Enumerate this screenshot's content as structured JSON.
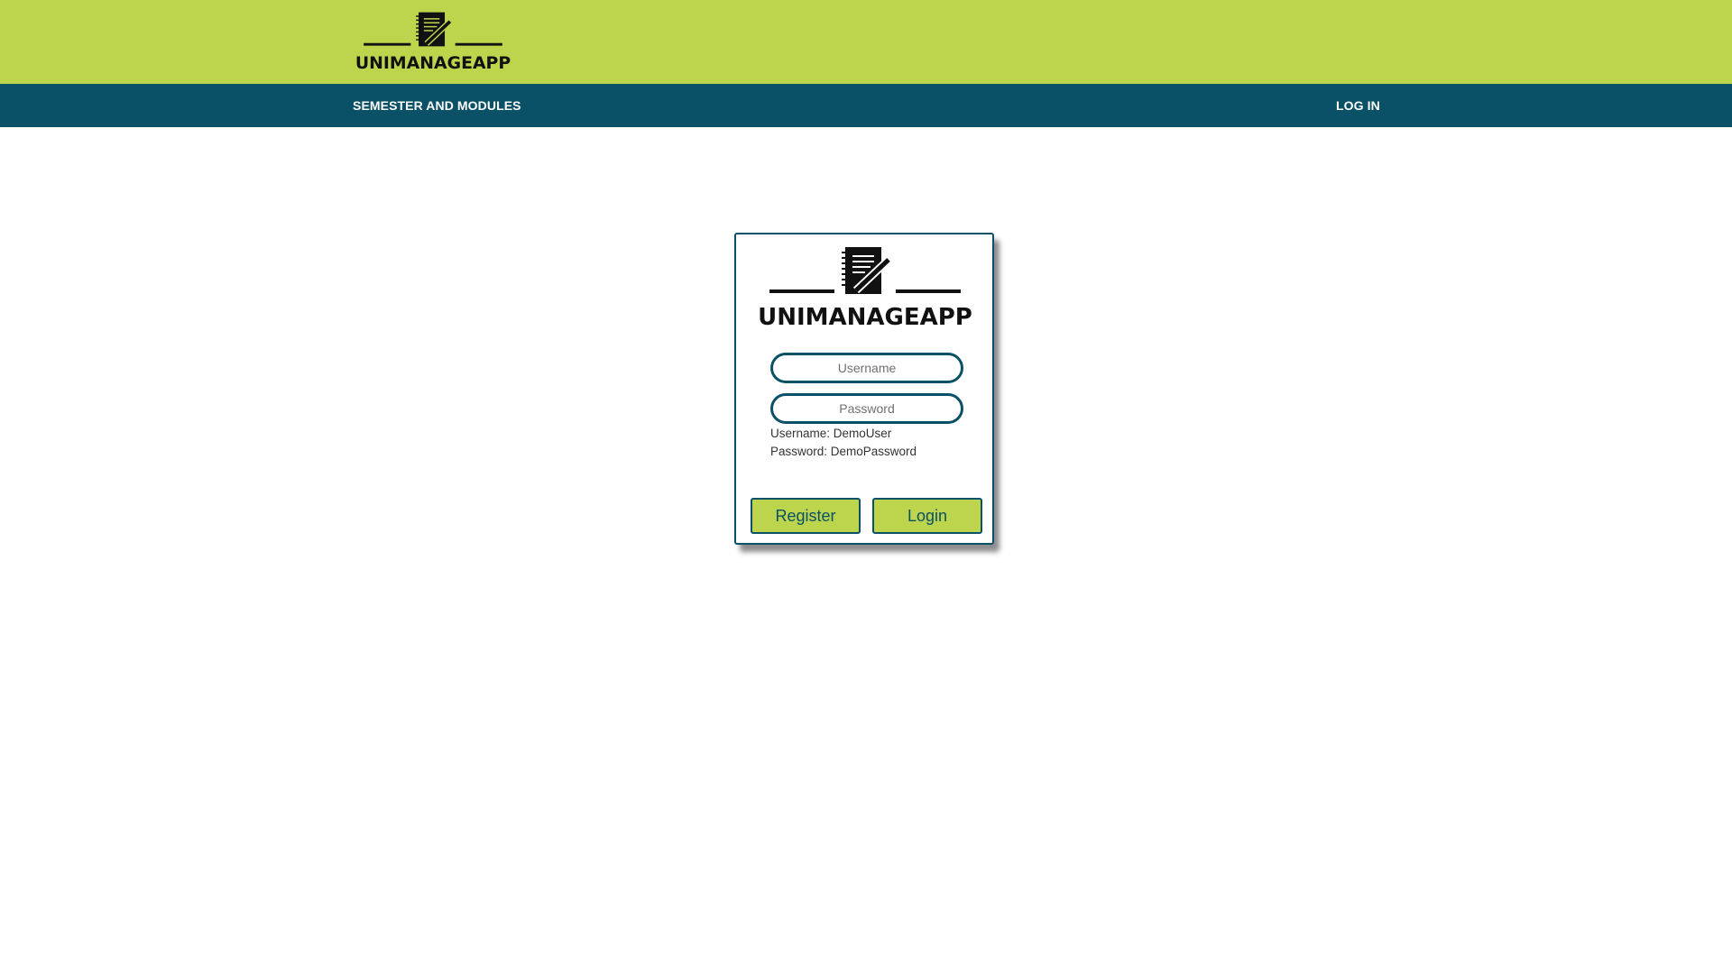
{
  "brand": {
    "name": "UNIMANAGEAPP",
    "logo_icon": "notebook-pen-icon",
    "colors": {
      "topbar": "#bdd44d",
      "navbar": "#0a5066",
      "accent": "#bdd44d",
      "border": "#0a5066"
    }
  },
  "nav": {
    "semester_modules": "SEMESTER AND MODULES",
    "login": "LOG IN"
  },
  "login_form": {
    "username_placeholder": "Username",
    "password_placeholder": "Password",
    "username_hint": "Username: DemoUser",
    "password_hint": "Password: DemoPassword",
    "register_label": "Register",
    "login_label": "Login"
  }
}
